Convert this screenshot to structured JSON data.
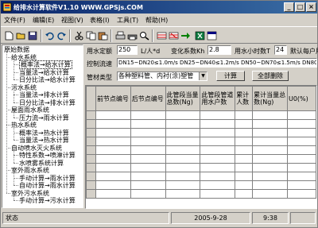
{
  "window": {
    "title": "给排水计算软件V1.10   WWW.GPSjs.COM"
  },
  "menu": [
    "文件(F)",
    "编辑(E)",
    "视图(V)",
    "表格(I)",
    "工具(T)",
    "帮助(H)"
  ],
  "toolbar_icons": [
    "new-icon",
    "open-icon",
    "save-icon",
    "undo-icon",
    "redo-icon",
    "cut-icon",
    "copy-icon",
    "paste-icon",
    "print-icon",
    "printer-icon",
    "find-icon",
    "grid-insert-icon",
    "grid-delete-icon",
    "arrow-right-icon",
    "excel-icon",
    "window-icon"
  ],
  "tree": {
    "root": "原始数据",
    "groups": [
      {
        "label": "给水系统",
        "items": [
          "概率法→给水计算",
          "当量法→给水计算",
          "日分比法→给水计算"
        ]
      },
      {
        "label": "污水系统",
        "items": [
          "当量法→排水计算",
          "日分比法→排水计算"
        ]
      },
      {
        "label": "屋面雨水系统",
        "items": [
          "压力流→雨水计算"
        ]
      },
      {
        "label": "热水系统",
        "items": [
          "概率法→热水计算",
          "当量法→热水计算"
        ]
      },
      {
        "label": "自动喷水灭火系统",
        "items": [
          "特性系数→喷淋计算",
          "水喷雾系统计算"
        ]
      },
      {
        "label": "室外雨水系统",
        "items": [
          "手动计算→雨水计算",
          "自动计算→雨水计算"
        ]
      },
      {
        "label": "室外污水系统",
        "items": [
          "手动计算→污水计算"
        ]
      }
    ]
  },
  "form": {
    "water_quota_label": "用水定额",
    "water_quota_value": "250",
    "water_quota_unit": "L/人*d",
    "variation_label": "变化系数Kh",
    "variation_value": "2.8",
    "hours_label": "用水小时数T",
    "hours_value": "24",
    "per_household_label": "默认每户用",
    "flow_control_label": "控制流速",
    "flow_control_value": "DN15~DN20≤1.0m/s DN25~DN40≤1.2m/s DN50~DN70≤1.5m/s DN80~≤",
    "pipe_type_label": "管材类型",
    "pipe_type_value": "各种塑料管、内衬(涂)塑管",
    "calc_button": "计算",
    "delete_all_button": "全部删除"
  },
  "grid": {
    "columns": [
      "前节点编号",
      "后节点编号",
      "此管段当量总数(Ng)",
      "此管段管道用水户数",
      "累计人数",
      "累计当量总数(Ng)",
      "U0(%)"
    ],
    "row_count": 10
  },
  "status": {
    "text": "状态",
    "date": "2005-9-28",
    "time": "9:38"
  }
}
